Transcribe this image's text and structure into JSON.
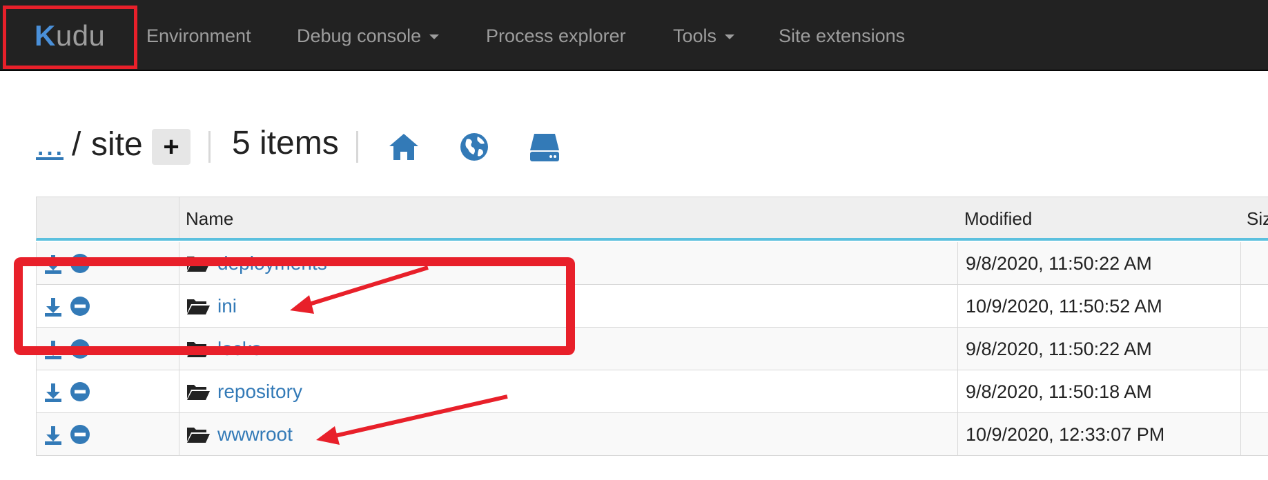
{
  "brand": {
    "prefix": "K",
    "rest": "udu"
  },
  "nav": {
    "environment": "Environment",
    "debug_console": "Debug console",
    "process_explorer": "Process explorer",
    "tools": "Tools",
    "site_extensions": "Site extensions"
  },
  "breadcrumb": {
    "up": "...",
    "separator": "/",
    "current": "site",
    "add_label": "+",
    "items_count": "5 items"
  },
  "toolbar_icons": [
    "home-icon",
    "globe-icon",
    "hard-drive-icon"
  ],
  "table": {
    "headers": {
      "actions": "",
      "name": "Name",
      "modified": "Modified",
      "size": "Siz"
    },
    "rows": [
      {
        "name": "deployments",
        "modified": "9/8/2020, 11:50:22 AM"
      },
      {
        "name": "ini",
        "modified": "10/9/2020, 11:50:52 AM"
      },
      {
        "name": "locks",
        "modified": "9/8/2020, 11:50:22 AM"
      },
      {
        "name": "repository",
        "modified": "9/8/2020, 11:50:18 AM"
      },
      {
        "name": "wwwroot",
        "modified": "10/9/2020, 12:33:07 PM"
      }
    ]
  },
  "colors": {
    "navbar_bg": "#222222",
    "link": "#337ab7",
    "header_underline": "#5bc0de",
    "annotation": "#e8202a"
  }
}
